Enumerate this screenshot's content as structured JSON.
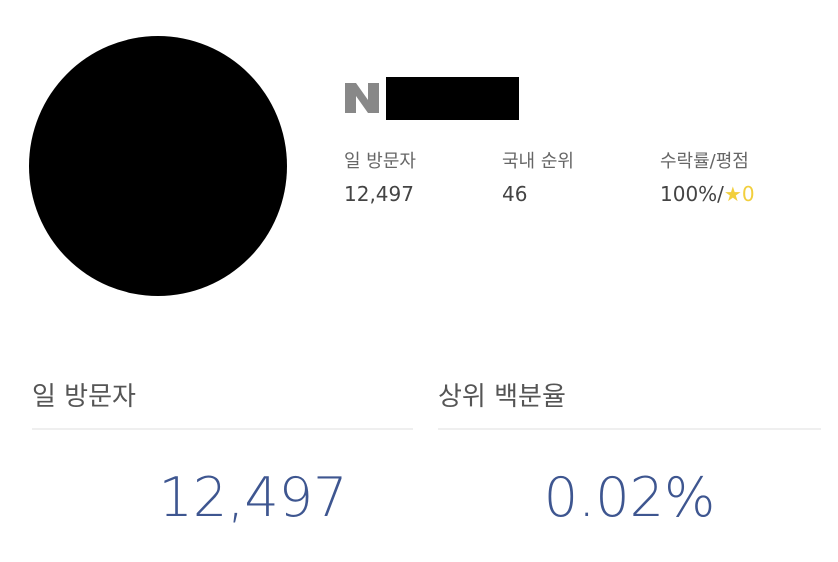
{
  "profile": {
    "platform_logo_letter": "N",
    "name": "",
    "avatar": "redacted"
  },
  "stats": [
    {
      "label": "일 방문자",
      "value": "12,497"
    },
    {
      "label": "국내 순위",
      "value": "46"
    },
    {
      "label": "수락률/평점",
      "value_prefix": "100%/",
      "star": "★",
      "rating": "0"
    }
  ],
  "sections": {
    "daily_visitors": {
      "title": "일 방문자",
      "value": "12,497"
    },
    "top_percentile": {
      "title": "상위 백분율",
      "value": "0.02%"
    }
  },
  "colors": {
    "accent": "#3e5690",
    "star": "#f2cf3d",
    "logo": "#888888"
  }
}
